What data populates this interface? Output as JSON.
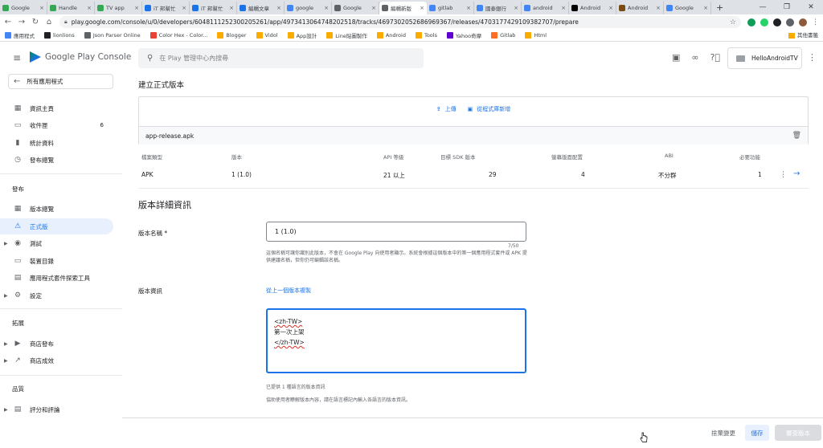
{
  "browser": {
    "tabs": [
      {
        "label": "Google",
        "color": "#34a853"
      },
      {
        "label": "Handle",
        "color": "#34a853"
      },
      {
        "label": "TV app",
        "color": "#34a853"
      },
      {
        "label": "iT 邦幫忙",
        "color": "#1a73e8"
      },
      {
        "label": "iT 邦幫忙",
        "color": "#1a73e8"
      },
      {
        "label": "編輯文章",
        "color": "#1a73e8"
      },
      {
        "label": "google",
        "color": "#4285f4"
      },
      {
        "label": "Google",
        "color": "#5f6368"
      },
      {
        "label": "編輯新版",
        "color": "#5f6368"
      },
      {
        "label": "gitlab",
        "color": "#4285f4"
      },
      {
        "label": "國泰銀行",
        "color": "#4285f4"
      },
      {
        "label": "android",
        "color": "#4285f4"
      },
      {
        "label": "Android",
        "color": "#000000"
      },
      {
        "label": "Android",
        "color": "#7a4b14"
      },
      {
        "label": "Google",
        "color": "#4285f4"
      }
    ],
    "active_tab": 8,
    "url": "play.google.com/console/u/0/developers/6048111252300205261/app/4973413064748202518/tracks/4697302052686969367/releases/4703177429109382707/prepare",
    "bookmarks": [
      {
        "label": "應用程式",
        "color": "#4285f4"
      },
      {
        "label": "lionlions",
        "color": "#202124"
      },
      {
        "label": "Json Parser Online",
        "color": "#5f6368"
      },
      {
        "label": "Color Hex - Color...",
        "color": "#ea4335"
      },
      {
        "label": "Blogger",
        "color": "#f9ab00"
      },
      {
        "label": "Vidol",
        "color": "#f9ab00"
      },
      {
        "label": "App設計",
        "color": "#f9ab00"
      },
      {
        "label": "Line貼圖製作",
        "color": "#f9ab00"
      },
      {
        "label": "Android",
        "color": "#f9ab00"
      },
      {
        "label": "Tools",
        "color": "#f9ab00"
      },
      {
        "label": "Yahoo奇摩",
        "color": "#6001d2"
      },
      {
        "label": "Gitlab",
        "color": "#fc6d26"
      },
      {
        "label": "Html",
        "color": "#f9ab00"
      }
    ],
    "other_bookmarks": "其他書籤"
  },
  "header": {
    "brand": "Google Play Console",
    "search_placeholder": "在 Play 管理中心內搜尋",
    "account": "HelloAndroidTV"
  },
  "sidebar": {
    "back_label": "所有應用程式",
    "top_items": [
      {
        "label": "資訊主頁",
        "icon": "▦",
        "count": ""
      },
      {
        "label": "收件匣",
        "icon": "▭",
        "count": "6"
      },
      {
        "label": "統計資料",
        "icon": "▮",
        "count": ""
      },
      {
        "label": "發布總覽",
        "icon": "◷",
        "count": ""
      }
    ],
    "section_release": "發布",
    "release_items": [
      {
        "label": "版本總覽",
        "icon": "▦",
        "caret": false,
        "active": false
      },
      {
        "label": "正式版",
        "icon": "⚠",
        "caret": false,
        "active": true
      },
      {
        "label": "測試",
        "icon": "◉",
        "caret": true,
        "active": false
      },
      {
        "label": "裝置目錄",
        "icon": "▭",
        "caret": false,
        "active": false
      },
      {
        "label": "應用程式套件探索工具",
        "icon": "▤",
        "caret": false,
        "active": false
      },
      {
        "label": "設定",
        "icon": "⚙",
        "caret": true,
        "active": false
      }
    ],
    "section_growth": "拓展",
    "growth_items": [
      {
        "label": "商店發布",
        "icon": "▶",
        "caret": true
      },
      {
        "label": "商店成效",
        "icon": "↗",
        "caret": true
      }
    ],
    "section_quality": "品質",
    "quality_items": [
      {
        "label": "評分和評論",
        "icon": "▤",
        "caret": true
      }
    ]
  },
  "main": {
    "page_title": "建立正式版本",
    "upload_label": "上傳",
    "library_label": "從程式庫新增",
    "file_name": "app-release.apk",
    "table": {
      "headers": [
        "檔案類型",
        "版本",
        "API 等級",
        "目標 SDK 版本",
        "螢幕版面配置",
        "ABI",
        "必要功能"
      ],
      "row": [
        "APK",
        "1 (1.0)",
        "21 以上",
        "29",
        "4",
        "不分群",
        "1"
      ]
    },
    "details_title": "版本詳細資訊",
    "name_label": "版本名稱 *",
    "name_value": "1 (1.0)",
    "name_counter": "7/50",
    "name_help": "這個名稱可讓你識別此版本，不會在 Google Play 向使用者顯示。系統會根據這個版本中的第一個應用程式套件或 APK 提供建議名稱，但你仍可編輯該名稱。",
    "notes_label": "版本資訊",
    "copy_link": "從上一個版本複製",
    "notes_line1": "<zh-TW>",
    "notes_line2": "第一次上架",
    "notes_line3": "</zh-TW>",
    "notes_hint1": "已提供 1 種語言的版本資訊",
    "notes_hint2": "協助使用者瞭解版本內容，請在語言標記內輸入各語言的版本資訊。"
  },
  "footer": {
    "discard": "捨棄變更",
    "save": "儲存",
    "review": "審查版本"
  }
}
